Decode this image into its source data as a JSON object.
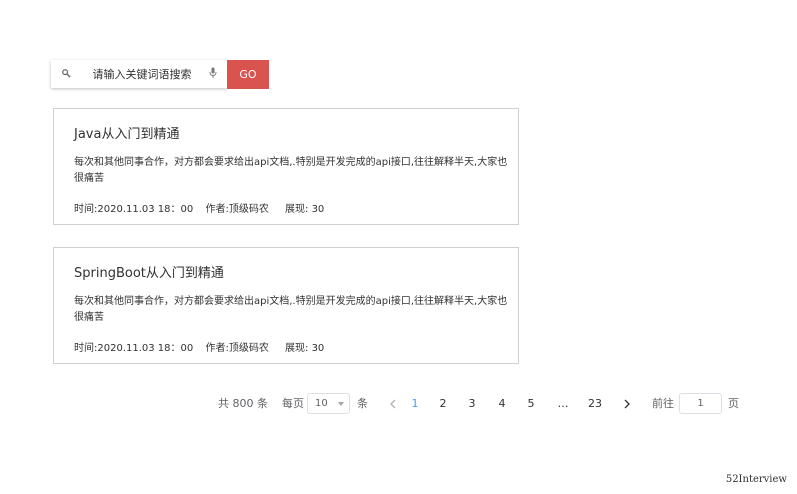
{
  "search": {
    "placeholder": "请输入关键词语搜索",
    "go_label": "GO"
  },
  "articles": [
    {
      "title": "Java从入门到精通",
      "description": "每次和其他同事合作，对方都会要求给出api文档,.特别是开发完成的api接口,往往解释半天,大家也很痛苦",
      "time": "时间:2020.11.03 18：00",
      "author": "作者:顶级码农",
      "views": "展现: 30"
    },
    {
      "title": "SpringBoot从入门到精通",
      "description": "每次和其他同事合作，对方都会要求给出api文档,.特别是开发完成的api接口,往往解释半天,大家也很痛苦",
      "time": "时间:2020.11.03 18：00",
      "author": "作者:顶级码农",
      "views": "展现: 30"
    }
  ],
  "pagination": {
    "total": "共 800 条",
    "page_size_label": "每页",
    "page_size": "10",
    "page_size_unit": "条",
    "pages": [
      "1",
      "2",
      "3",
      "4",
      "5",
      "…",
      "23"
    ],
    "current_page": "1",
    "goto_label": "前往",
    "goto_value": "1",
    "goto_unit": "页",
    "active_color": "#409eff"
  },
  "colors": {
    "go_button": "#d9534f",
    "card_border": "#d0d0d0"
  },
  "icons": {
    "search": "search-icon",
    "mic": "mic-icon",
    "prev": "chevron-left-icon",
    "next": "chevron-right-icon",
    "dropdown": "caret-down-icon"
  },
  "watermark": "52Interview"
}
